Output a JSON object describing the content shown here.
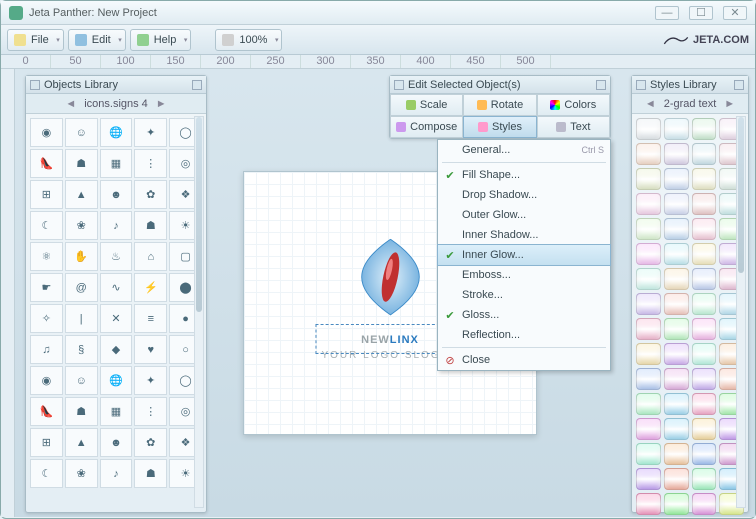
{
  "window": {
    "title": "Jeta Panther: New Project"
  },
  "menu": {
    "file": "File",
    "edit": "Edit",
    "help": "Help",
    "zoom": "100%",
    "brand": "JETA.COM"
  },
  "ruler": [
    "0",
    "50",
    "100",
    "150",
    "200",
    "250",
    "300",
    "350",
    "400",
    "450",
    "500"
  ],
  "objects_library": {
    "title": "Objects Library",
    "category": "icons.signs 4",
    "icons": [
      "device",
      "person",
      "globe",
      "radiate",
      "clock",
      "shoe",
      "family",
      "pattern",
      "dots",
      "target",
      "car",
      "triangle",
      "face",
      "tree",
      "blob",
      "moon",
      "leaf",
      "sax",
      "man",
      "sun",
      "atom",
      "hand",
      "flame",
      "house",
      "box",
      "hand2",
      "at",
      "swirl",
      "bolt",
      "pin",
      "wrench",
      "line",
      "compass",
      "stripes",
      "disc",
      "violin",
      "spiral",
      "shapes",
      "drop",
      "circle",
      "violin2",
      "spiral2",
      "whale",
      "drop2",
      "ring",
      "misc1",
      "misc2",
      "misc3",
      "misc4",
      "misc5",
      "misc6",
      "misc7",
      "misc8",
      "misc9",
      "misc10",
      "x1",
      "x2",
      "x3",
      "x4",
      "x5"
    ]
  },
  "edit_panel": {
    "title": "Edit Selected Object(s)",
    "buttons": {
      "scale": "Scale",
      "rotate": "Rotate",
      "colors": "Colors",
      "compose": "Compose",
      "styles": "Styles",
      "text": "Text"
    }
  },
  "styles_menu": {
    "general": "General...",
    "general_shortcut": "Ctrl S",
    "fill": "Fill Shape...",
    "drop": "Drop Shadow...",
    "outer": "Outer Glow...",
    "innershadow": "Inner Shadow...",
    "innerglow": "Inner Glow...",
    "emboss": "Emboss...",
    "stroke": "Stroke...",
    "gloss": "Gloss...",
    "reflection": "Reflection...",
    "close": "Close"
  },
  "styles_library": {
    "title": "Styles Library",
    "category": "2-grad text",
    "colors": [
      "#e8eef2",
      "#d8f0f8",
      "#d0f0d8",
      "#f0e0f0",
      "#f8e0d0",
      "#e0d8f0",
      "#d0e8f0",
      "#f0d8e0",
      "#e8f0d0",
      "#d0e0f8",
      "#f0f0d0",
      "#e0f0e8",
      "#f8d8f0",
      "#d8e0f8",
      "#f0d0d0",
      "#d0f0f0",
      "#e0f8d8",
      "#c8e0f8",
      "#f8d0e0",
      "#d0f8d0",
      "#f8c8f8",
      "#c8f0f8",
      "#f8f0c8",
      "#e0c8f8",
      "#d0f8f0",
      "#f8e8c8",
      "#c8d8f8",
      "#f0c8e0",
      "#d8c8f8",
      "#f8d0c8",
      "#c8f8e0",
      "#c0e8f8",
      "#f8c0d8",
      "#c0f8c8",
      "#f8c0f0",
      "#b8e8f8",
      "#f8e8b8",
      "#d8b8f8",
      "#c0f8e8",
      "#f8d8b8",
      "#b8d0f8",
      "#e8b8e8",
      "#d0b8f8",
      "#f8c8b8",
      "#b8f8d0",
      "#a8e0f8",
      "#f8b0d0",
      "#b0f8b8",
      "#f0b0f0",
      "#a8e0f8",
      "#f8e0a8",
      "#d0a8f8",
      "#b0f8e0",
      "#f8d0a8",
      "#a8c8f8",
      "#e0a8e0",
      "#c8a8f8",
      "#f8b8a8",
      "#a8f8c8",
      "#98d8f8",
      "#f8a0c8",
      "#a0f8a8",
      "#e8a0e8",
      "#e8f898"
    ]
  },
  "canvas": {
    "logo_gray": "NEW",
    "logo_blue": "LINX",
    "slogan": "YOUR LOGO SLOGAN"
  }
}
